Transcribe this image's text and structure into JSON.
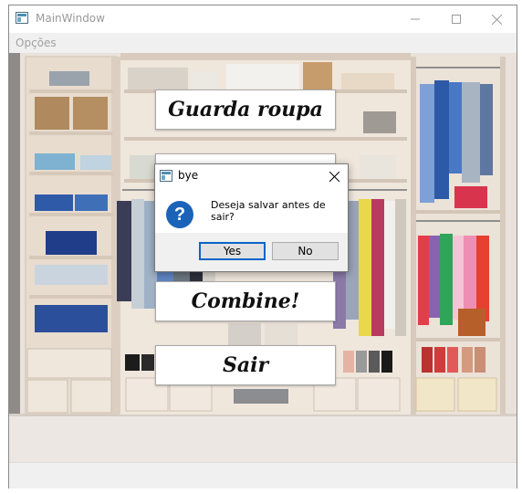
{
  "window": {
    "title": "MainWindow"
  },
  "menubar": {
    "items": [
      "Opções"
    ]
  },
  "main_buttons": {
    "guarda_roupa": "Guarda roupa",
    "combine": "Combine!",
    "sair": "Sair"
  },
  "dialog": {
    "title": "bye",
    "message": "Deseja salvar antes de sair?",
    "yes": "Yes",
    "no": "No"
  },
  "colors": {
    "dialog_icon": "#1b63b8",
    "default_button_border": "#0a64c7"
  }
}
